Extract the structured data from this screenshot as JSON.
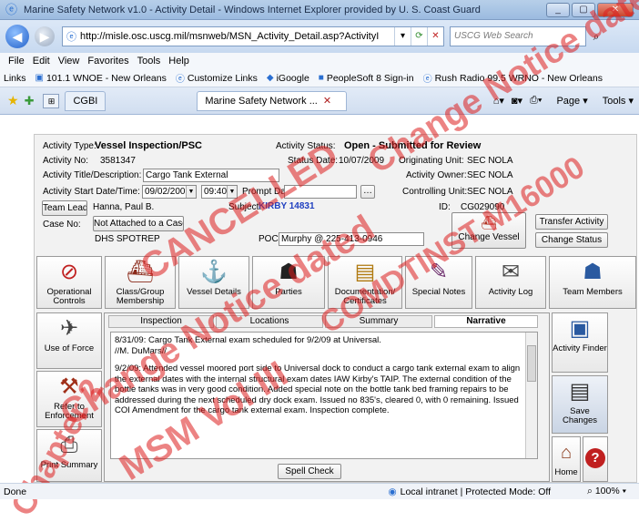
{
  "window": {
    "title": "Marine Safety Network v1.0 - Activity Detail - Windows Internet Explorer provided by U. S. Coast Guard",
    "minimize": "_",
    "maximize": "▢",
    "close": "✕"
  },
  "nav": {
    "address": "http://misle.osc.uscg.mil/msnweb/MSN_Activity_Detail.asp?ActivityI",
    "search_placeholder": "USCG Web Search"
  },
  "menu": [
    "File",
    "Edit",
    "View",
    "Favorites",
    "Tools",
    "Help"
  ],
  "links": {
    "label": "Links",
    "items": [
      "101.1 WNOE - New Orleans",
      "Customize Links",
      "iGoogle",
      "PeopleSoft 8 Sign-in",
      "Rush Radio 99.5 WRNO - New Orleans"
    ]
  },
  "browser_tabs": {
    "first": "CGBI",
    "active": "Marine Safety Network ..."
  },
  "commands": {
    "page": "Page",
    "tools": "Tools"
  },
  "activity": {
    "type_label": "Activity Type:",
    "type_value": "Vessel Inspection/PSC",
    "status_label": "Activity Status:",
    "status_value": "Open - Submitted for Review",
    "no_label": "Activity No:",
    "no_value": "3581347",
    "status_date_label": "Status Date:",
    "status_date_value": "10/07/2009",
    "orig_unit_label": "Originating Unit:",
    "orig_unit_value": "SEC NOLA",
    "title_label": "Activity Title/Description:",
    "title_value": "Cargo Tank External",
    "owner_label": "Activity Owner:",
    "owner_value": "SEC NOLA",
    "start_label": "Activity Start Date/Time:",
    "start_date": "09/02/2009",
    "start_time": "09:40",
    "prompt_label": "Prompt Date:",
    "controlling_label": "Controlling Unit:",
    "controlling_value": "SEC NOLA",
    "team_lead_button": "Team Lead",
    "team_lead_value": "Hanna, Paul B.",
    "subject_label": "Subject:",
    "subject_value": "KIRBY 14831",
    "id_label": "ID:",
    "id_value": "CG029090",
    "case_label": "Case No:",
    "case_button": "Not Attached to a Case",
    "dhs_label": "DHS SPOTREP",
    "poc_label": "POC:",
    "poc_value": "Murphy @ 225-413-0946",
    "change_vessel": "Change Vessel",
    "transfer_activity": "Transfer Activity",
    "change_status": "Change Status"
  },
  "icon_buttons": [
    {
      "label": "Operational Controls",
      "icon": "no-entry-icon"
    },
    {
      "label": "Class/Group Membership",
      "icon": "ship-group-icon"
    },
    {
      "label": "Vessel Details",
      "icon": "vessel-icon"
    },
    {
      "label": "Parties",
      "icon": "person-icon"
    },
    {
      "label": "Documentation/ Certificates",
      "icon": "documents-icon"
    },
    {
      "label": "Special Notes",
      "icon": "notes-icon"
    },
    {
      "label": "Activity Log",
      "icon": "log-icon"
    },
    {
      "label": "Team Members",
      "icon": "team-icon"
    }
  ],
  "left_buttons": [
    {
      "label": "Use of Force",
      "icon": "force-icon"
    },
    {
      "label": "Refer to Enforcement",
      "icon": "gavel-icon"
    },
    {
      "label": "Print Summary",
      "icon": "printer-icon"
    }
  ],
  "right_buttons": {
    "finder": "Activity Finder",
    "save": "Save Changes",
    "home": "Home",
    "help": "?"
  },
  "panel_tabs": [
    "Inspection",
    "Locations",
    "Summary",
    "Narrative"
  ],
  "narrative": [
    "8/31/09: Cargo Tank External exam scheduled for 9/2/09 at Universal.",
    "//M. DuMars//",
    "9/2/09: Attended vessel moored port side to Universal dock to conduct a cargo tank external exam to align the external dates with the internal structural exam dates IAW Kirby's TAIP. The external condition of the bottle tanks was in very good condition. Added special note on the bottle tank bed framing repairs to be addressed during the next scheduled dry dock exam. Issued no 835's, cleared 0, with 0 remaining. Issued COI Amendment for the cargo tank external exam. Inspection complete."
  ],
  "spell_check": "Spell Check",
  "status": {
    "left": "Done",
    "zone": "Local intranet | Protected Mode: Off",
    "zoom": "100%"
  },
  "watermark": [
    "CANCELLED",
    "Change Notice dated",
    "COMDTINST M16000",
    "Change Notice dated",
    "MSM Vol III",
    "Chapter 2"
  ]
}
